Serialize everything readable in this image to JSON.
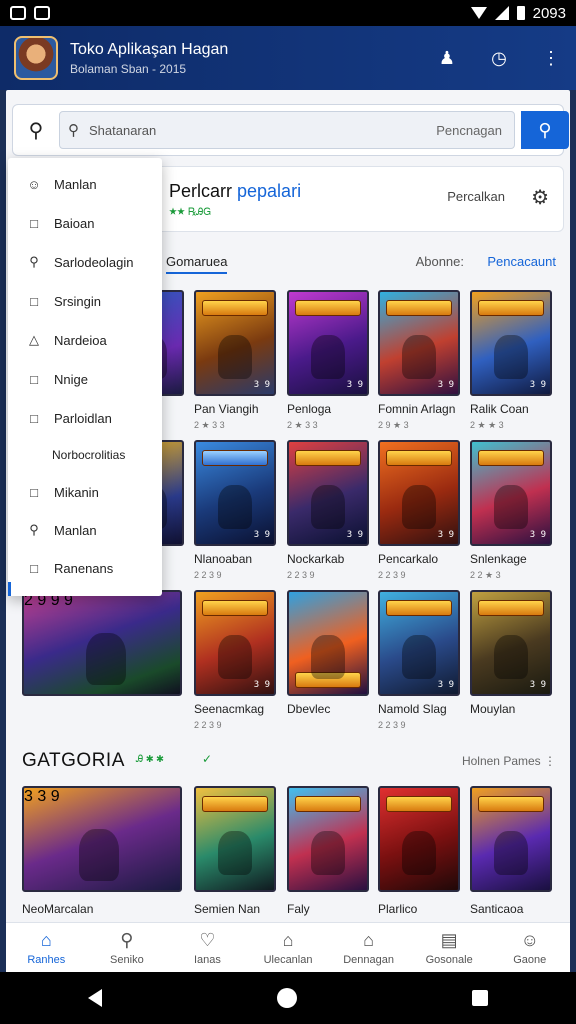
{
  "status_bar": {
    "time": "2093"
  },
  "app_bar": {
    "title": "Toko Aplikaşan Hagan",
    "subtitle": "Bolaman Sban - 2015"
  },
  "search": {
    "placeholder": "Shatanaran",
    "hint": "Pencnagan"
  },
  "popular": {
    "title_dark": "Perlcarr ",
    "title_blue": "pepalari",
    "sub": "★★ ℞ᎯᏀ",
    "right_label": "Percalkan"
  },
  "tabs": {
    "active": "Gomaruea",
    "middle": "Abonne:",
    "right": "Pencacaunt"
  },
  "menu": {
    "items": [
      {
        "label": "Manlan",
        "icon": "user"
      },
      {
        "label": "Baioan",
        "icon": "square"
      },
      {
        "label": "Sarlodeolagin",
        "icon": "search"
      },
      {
        "label": "Srsingin",
        "icon": "square"
      },
      {
        "label": "Nardeioa",
        "icon": "triangle"
      },
      {
        "label": "Nnige",
        "icon": "square"
      },
      {
        "label": "Parloidlan",
        "icon": "square"
      },
      {
        "label": "Norbocrolitias",
        "icon": ""
      },
      {
        "label": "Mikanin",
        "icon": "square"
      },
      {
        "label": "Manlan",
        "icon": "search"
      },
      {
        "label": "Ranenans",
        "icon": "square"
      }
    ]
  },
  "games": [
    {
      "name": "Pan Viangih",
      "stat": "2 ★ 3 3",
      "rating": "3 9"
    },
    {
      "name": "Penloga",
      "stat": "2 ★ 3 3",
      "rating": "3 9"
    },
    {
      "name": "Fomnin Arlagn",
      "stat": "2 9 ★ 3",
      "rating": "3 9"
    },
    {
      "name": "Ralik Coan",
      "stat": "2 ★ ★ 3",
      "rating": "3 9"
    },
    {
      "name": "Nlanoaban",
      "stat": "2 2 3 9",
      "rating": "3 9"
    },
    {
      "name": "Nockarkab",
      "stat": "2 2 3 9",
      "rating": "3 9"
    },
    {
      "name": "Pencarkalo",
      "stat": "2 2 3 9",
      "rating": "3 9"
    },
    {
      "name": "Snlenkage",
      "stat": "2 2 ★ 3",
      "rating": "3 9"
    },
    {
      "name": "Seenacmkag",
      "stat": "2 2 3 9",
      "rating": "3 9"
    },
    {
      "name": "Dbevlec",
      "stat": "",
      "rating": ""
    },
    {
      "name": "Namold Slag",
      "stat": "2 2 3 9",
      "rating": "3 9"
    },
    {
      "name": "Mouylan",
      "stat": "",
      "rating": "3 9"
    }
  ],
  "wide_rating": "2 9 9 9",
  "category": {
    "title": "GATGORIA",
    "badge": "Ꭿ ✱ ✱",
    "check": "✓",
    "more": "Holnen Pames ⋮"
  },
  "category_games": [
    {
      "name": "NeoMarcalan",
      "rating": "3 3 9"
    },
    {
      "name": "Semien Nan"
    },
    {
      "name": "Faly"
    },
    {
      "name": "Plarlico"
    },
    {
      "name": "Santicaoa"
    }
  ],
  "bottom_nav": [
    {
      "label": "Ranhes",
      "icon": "⌂"
    },
    {
      "label": "Seniko",
      "icon": "⚲"
    },
    {
      "label": "Ianas",
      "icon": "♡"
    },
    {
      "label": "Ulecanlan",
      "icon": "⌂"
    },
    {
      "label": "Dennagan",
      "icon": "⌂"
    },
    {
      "label": "Gosonale",
      "icon": "▤"
    },
    {
      "label": "Gaone",
      "icon": "☺"
    }
  ]
}
